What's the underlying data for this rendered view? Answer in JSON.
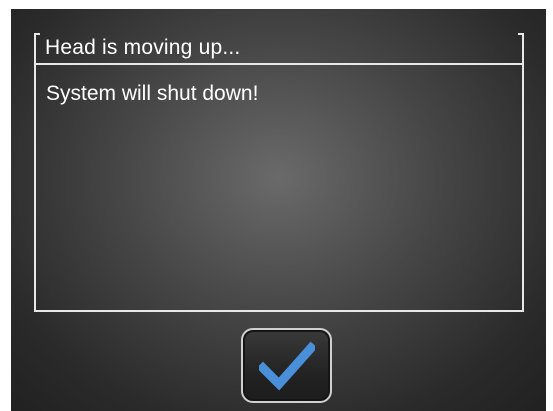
{
  "dialog": {
    "title": "Head is moving up...",
    "message": "System will shut down!"
  },
  "ok_button": {
    "icon": "checkmark-icon",
    "icon_color": "#4a90d9"
  },
  "colors": {
    "background": "#3a3a3a",
    "text": "#ffffff",
    "frame": "#e8e8e8"
  }
}
